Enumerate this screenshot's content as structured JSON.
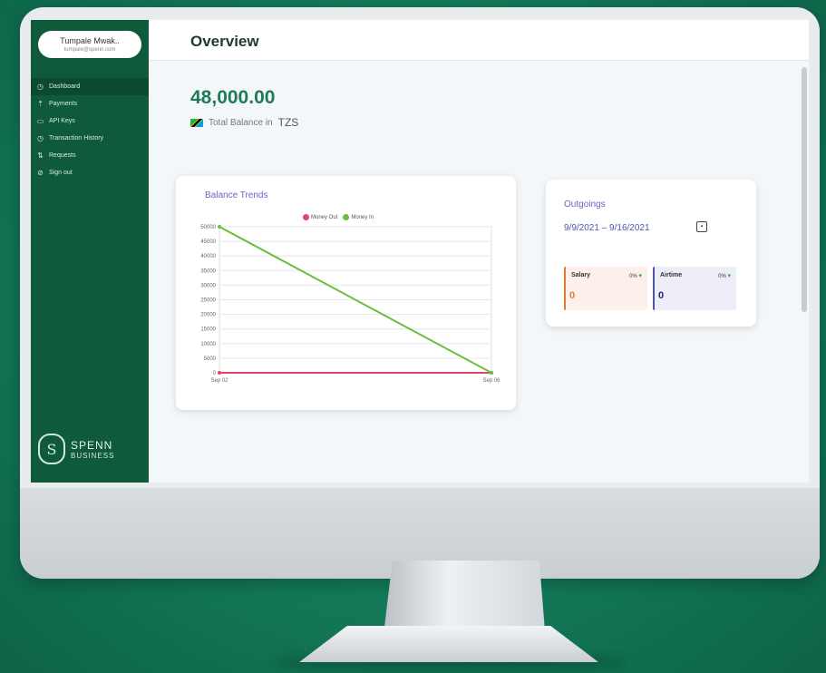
{
  "user": {
    "name": "Tumpale Mwak..",
    "email": "tumpale@spenn.com"
  },
  "nav": [
    {
      "label": "Dashboard",
      "icon": "clock-icon"
    },
    {
      "label": "Payments",
      "icon": "upload-icon"
    },
    {
      "label": "API Keys",
      "icon": "key-icon"
    },
    {
      "label": "Transaction History",
      "icon": "history-icon"
    },
    {
      "label": "Requests",
      "icon": "requests-icon"
    },
    {
      "label": "Sign out",
      "icon": "sign-out-icon"
    }
  ],
  "brand": {
    "name": "SPENN",
    "sub": "BUSINESS"
  },
  "header": {
    "title": "Overview"
  },
  "balance": {
    "amount": "48,000.00",
    "label": "Total Balance in",
    "currency": "TZS"
  },
  "trend": {
    "title": "Balance Trends",
    "legend": [
      "Money Out",
      "Money In"
    ]
  },
  "chart_data": {
    "type": "line",
    "title": "Balance Trends",
    "x": [
      "Sep 02",
      "Sep 06"
    ],
    "series": [
      {
        "name": "Money Out",
        "values": [
          0,
          0
        ],
        "color": "#e0456a"
      },
      {
        "name": "Money In",
        "values": [
          50000,
          0
        ],
        "color": "#6abf3f"
      }
    ],
    "yticks": [
      0,
      5000,
      10000,
      15000,
      20000,
      25000,
      30000,
      35000,
      40000,
      45000,
      50000
    ],
    "ylim": [
      0,
      50000
    ],
    "grid": true,
    "legend_position": "top"
  },
  "outgoings": {
    "title": "Outgoings",
    "range": "9/9/2021 – 9/16/2021",
    "salary": {
      "label": "Salary",
      "pct": "0%",
      "value": "0"
    },
    "airtime": {
      "label": "Airtime",
      "pct": "0%",
      "value": "0"
    }
  }
}
